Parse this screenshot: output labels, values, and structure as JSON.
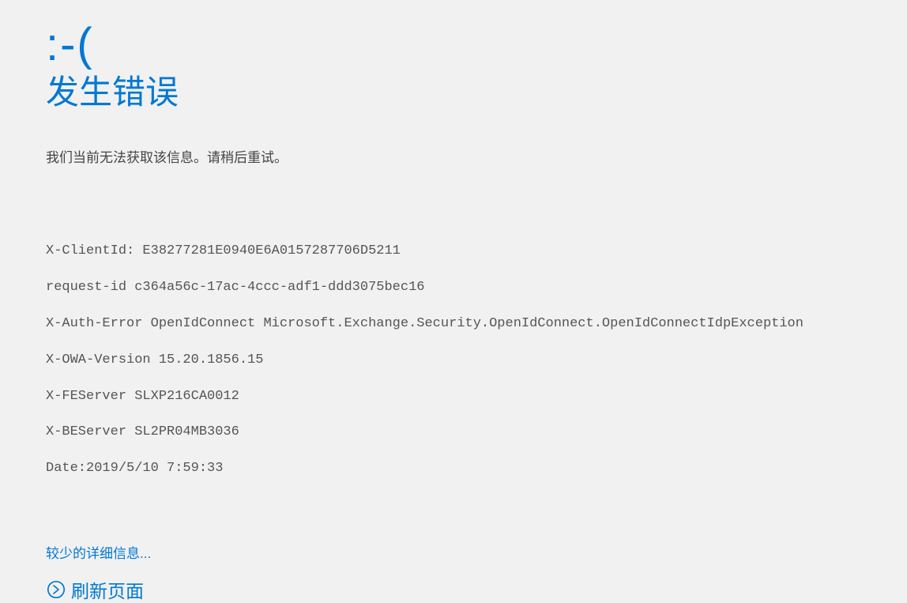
{
  "error": {
    "face": ":-(",
    "title": "发生错误",
    "message": "我们当前无法获取该信息。请稍后重试。"
  },
  "details": {
    "lines": [
      "X-ClientId: E38277281E0940E6A0157287706D5211",
      "request-id c364a56c-17ac-4ccc-adf1-ddd3075bec16",
      "X-Auth-Error OpenIdConnect Microsoft.Exchange.Security.OpenIdConnect.OpenIdConnectIdpException",
      "X-OWA-Version 15.20.1856.15",
      "X-FEServer SLXP216CA0012",
      "X-BEServer SL2PR04MB3036",
      "Date:2019/5/10 7:59:33"
    ]
  },
  "actions": {
    "toggle_label": "较少的详细信息...",
    "refresh_label": "刷新页面"
  }
}
